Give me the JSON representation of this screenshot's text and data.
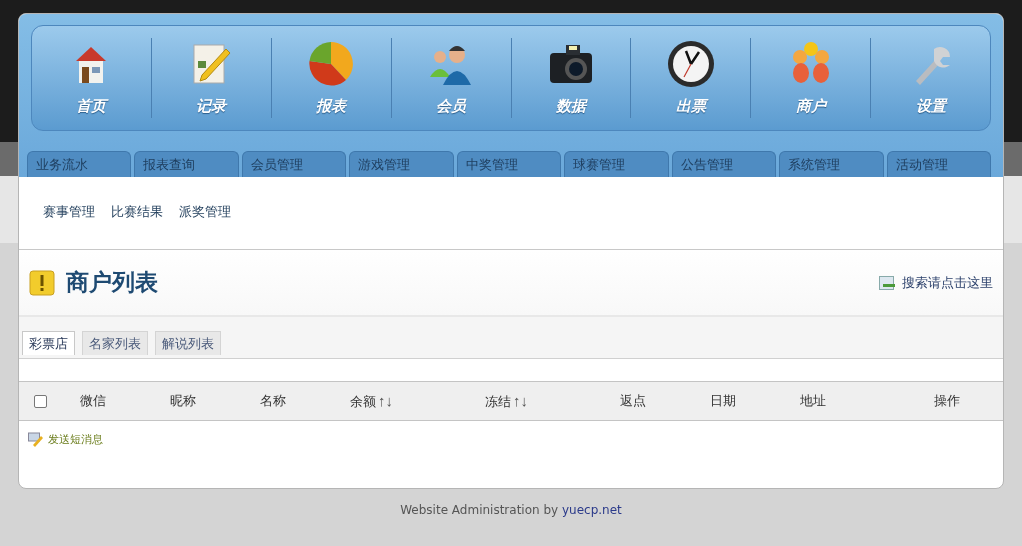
{
  "nav": [
    {
      "label": "首页",
      "kind": "home"
    },
    {
      "label": "记录",
      "kind": "record"
    },
    {
      "label": "报表",
      "kind": "report"
    },
    {
      "label": "会员",
      "kind": "members"
    },
    {
      "label": "数据",
      "kind": "camera"
    },
    {
      "label": "出票",
      "kind": "clock"
    },
    {
      "label": "商户",
      "kind": "merchant"
    },
    {
      "label": "设置",
      "kind": "settings"
    }
  ],
  "menu_tabs": [
    "业务流水",
    "报表查询",
    "会员管理",
    "游戏管理",
    "中奖管理",
    "球赛管理",
    "公告管理",
    "系统管理",
    "活动管理"
  ],
  "sub_links": [
    "赛事管理",
    "比赛结果",
    "派奖管理"
  ],
  "page_title": "商户列表",
  "search_link": "搜索请点击这里",
  "list_tabs": [
    {
      "label": "彩票店",
      "selected": true
    },
    {
      "label": "名家列表",
      "selected": false
    },
    {
      "label": "解说列表",
      "selected": false
    }
  ],
  "table": {
    "select_all": {
      "checked": false
    },
    "columns": [
      {
        "label": "微信"
      },
      {
        "label": "昵称"
      },
      {
        "label": "名称"
      },
      {
        "label": "余额",
        "sort": "↑↓"
      },
      {
        "label": "冻结",
        "sort": "↑↓"
      },
      {
        "label": "返点"
      },
      {
        "label": "日期"
      },
      {
        "label": "地址"
      },
      {
        "label": "操作"
      }
    ]
  },
  "send_message": "发送短消息",
  "footer": {
    "text": "Website Administration by",
    "link": "yuecp.net"
  }
}
